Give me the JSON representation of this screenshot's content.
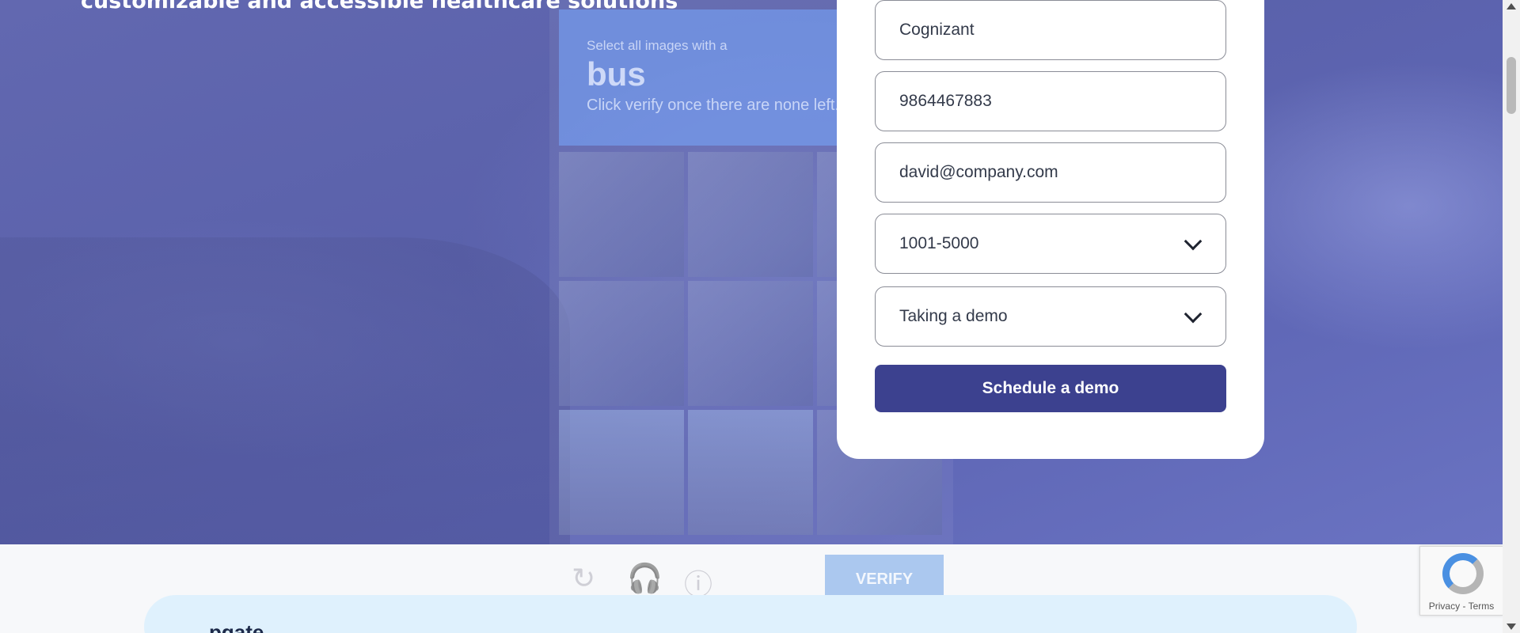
{
  "hero": {
    "headline": "customizable and accessible healthcare solutions"
  },
  "captcha": {
    "prompt": "Select all images with a",
    "target": "bus",
    "instruction": "Click verify once there are none left.",
    "verify_label": "VERIFY",
    "icons": [
      "refresh-icon",
      "audio-icon",
      "info-icon"
    ]
  },
  "form": {
    "company": "Cognizant",
    "phone": "9864467883",
    "email": "david@company.com",
    "company_size": "1001-5000",
    "interest": "Taking a demo",
    "submit_label": "Schedule a demo"
  },
  "lower": {
    "logo_text": "pgate"
  },
  "recaptcha": {
    "privacy": "Privacy",
    "separator": " - ",
    "terms": "Terms"
  },
  "colors": {
    "hero_overlay": "#5f66b0",
    "submit_bg": "#3c418f",
    "lower_panel": "#dff1fd"
  }
}
